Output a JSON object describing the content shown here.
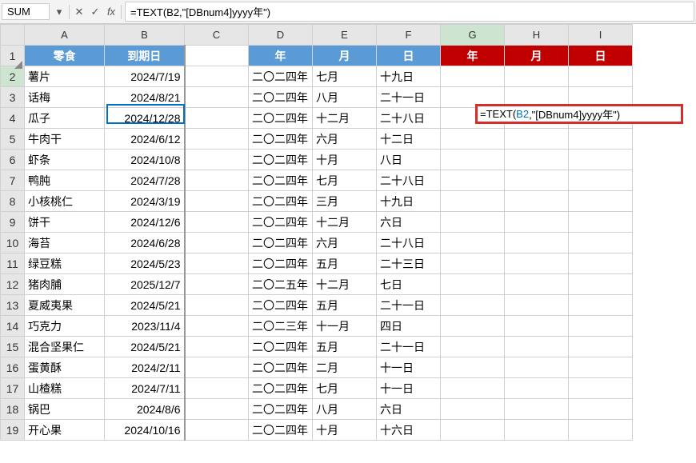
{
  "name_box": "SUM",
  "formula_bar": "=TEXT(B2,\"[DBnum4]yyyy年\")",
  "columns": [
    "A",
    "B",
    "C",
    "D",
    "E",
    "F",
    "G",
    "H",
    "I"
  ],
  "row_count": 19,
  "headers_row1": {
    "A": "零食",
    "B": "到期日",
    "D": "年",
    "E": "月",
    "F": "日",
    "G": "年",
    "H": "月",
    "I": "日"
  },
  "rows": [
    {
      "a": "薯片",
      "b": "2024/7/19",
      "d": "二〇二四年",
      "e": "七月",
      "f": "十九日"
    },
    {
      "a": "话梅",
      "b": "2024/8/21",
      "d": "二〇二四年",
      "e": "八月",
      "f": "二十一日"
    },
    {
      "a": "瓜子",
      "b": "2024/12/28",
      "d": "二〇二四年",
      "e": "十二月",
      "f": "二十八日"
    },
    {
      "a": "牛肉干",
      "b": "2024/6/12",
      "d": "二〇二四年",
      "e": "六月",
      "f": "十二日"
    },
    {
      "a": "虾条",
      "b": "2024/10/8",
      "d": "二〇二四年",
      "e": "十月",
      "f": "八日"
    },
    {
      "a": "鸭肫",
      "b": "2024/7/28",
      "d": "二〇二四年",
      "e": "七月",
      "f": "二十八日"
    },
    {
      "a": "小核桃仁",
      "b": "2024/3/19",
      "d": "二〇二四年",
      "e": "三月",
      "f": "十九日"
    },
    {
      "a": "饼干",
      "b": "2024/12/6",
      "d": "二〇二四年",
      "e": "十二月",
      "f": "六日"
    },
    {
      "a": "海苔",
      "b": "2024/6/28",
      "d": "二〇二四年",
      "e": "六月",
      "f": "二十八日"
    },
    {
      "a": "绿豆糕",
      "b": "2024/5/23",
      "d": "二〇二四年",
      "e": "五月",
      "f": "二十三日"
    },
    {
      "a": "猪肉脯",
      "b": "2025/12/7",
      "d": "二〇二五年",
      "e": "十二月",
      "f": "七日"
    },
    {
      "a": "夏威夷果",
      "b": "2024/5/21",
      "d": "二〇二四年",
      "e": "五月",
      "f": "二十一日"
    },
    {
      "a": "巧克力",
      "b": "2023/11/4",
      "d": "二〇二三年",
      "e": "十一月",
      "f": "四日"
    },
    {
      "a": "混合坚果仁",
      "b": "2024/5/21",
      "d": "二〇二四年",
      "e": "五月",
      "f": "二十一日"
    },
    {
      "a": "蛋黄酥",
      "b": "2024/2/11",
      "d": "二〇二四年",
      "e": "二月",
      "f": "十一日"
    },
    {
      "a": "山楂糕",
      "b": "2024/7/11",
      "d": "二〇二四年",
      "e": "七月",
      "f": "十一日"
    },
    {
      "a": "锅巴",
      "b": "2024/8/6",
      "d": "二〇二四年",
      "e": "八月",
      "f": "六日"
    },
    {
      "a": "开心果",
      "b": "2024/10/16",
      "d": "二〇二四年",
      "e": "十月",
      "f": "十六日"
    }
  ],
  "editing_formula": {
    "prefix": "=TEXT(",
    "ref": "B2",
    "suffix": ",\"[DBnum4]yyyy年\")"
  },
  "icons": {
    "cancel": "✕",
    "enter": "✓",
    "fx": "fx",
    "dropdown": "▾"
  }
}
